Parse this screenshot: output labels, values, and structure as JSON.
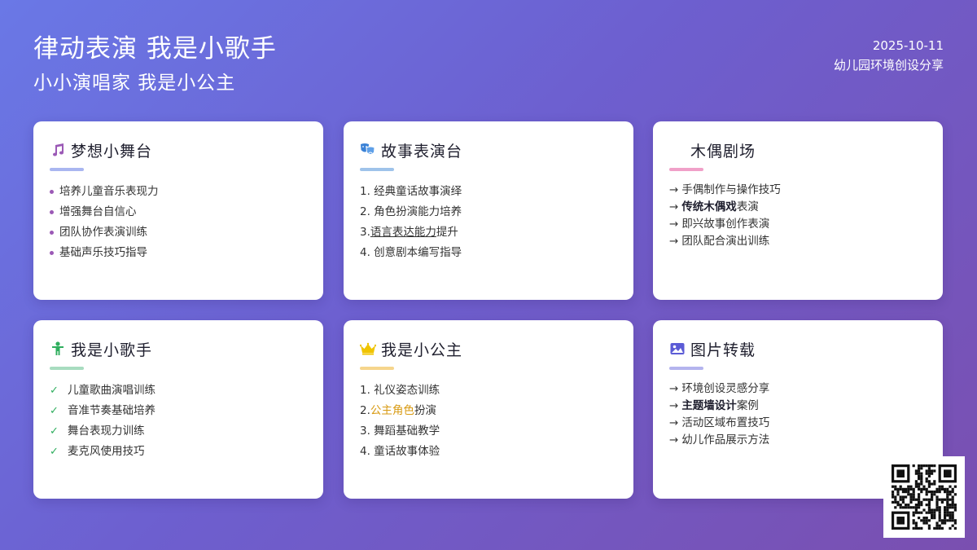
{
  "header": {
    "title": "律动表演 我是小歌手",
    "subtitle": "小小演唱家 我是小公主",
    "date": "2025-10-11",
    "tagline": "幼儿园环境创设分享"
  },
  "colors": {
    "purple": "#9b59b6",
    "blue": "#3b82d6",
    "pink": "#f0a0c8",
    "green": "#2fae5e",
    "gold": "#f0c400",
    "indigo": "#5b5bd6"
  },
  "cards": [
    {
      "title": "梦想小舞台",
      "icon": "music-note-icon",
      "items": [
        "培养儿童音乐表现力",
        "增强舞台自信心",
        "团队协作表演训练",
        "基础声乐技巧指导"
      ]
    },
    {
      "title": "故事表演台",
      "icon": "theater-masks-icon",
      "items": [
        "1. 经典童话故事演绎",
        "2. 角色扮演能力培养",
        "3. ",
        "语言表达能力",
        "提升",
        "4. 创意剧本编写指导"
      ]
    },
    {
      "title": "木偶剧场",
      "icon": "",
      "items": [
        "手偶制作与操作技巧",
        "传统木偶戏",
        "表演",
        "即兴故事创作表演",
        "团队配合演出训练"
      ]
    },
    {
      "title": "我是小歌手",
      "icon": "child-icon",
      "items": [
        "儿童歌曲演唱训练",
        "音准节奏基础培养",
        "舞台表现力训练",
        "麦克风使用技巧"
      ]
    },
    {
      "title": "我是小公主",
      "icon": "crown-icon",
      "items": [
        "1. 礼仪姿态训练",
        "2. ",
        "公主角色",
        "扮演",
        "3. 舞蹈基础教学",
        "4. 童话故事体验"
      ]
    },
    {
      "title": "图片转载",
      "icon": "image-icon",
      "items": [
        "环境创设灵感分享",
        "主题墙设计",
        "案例",
        "活动区域布置技巧",
        "幼儿作品展示方法"
      ]
    }
  ],
  "arrow_glyph": "→"
}
